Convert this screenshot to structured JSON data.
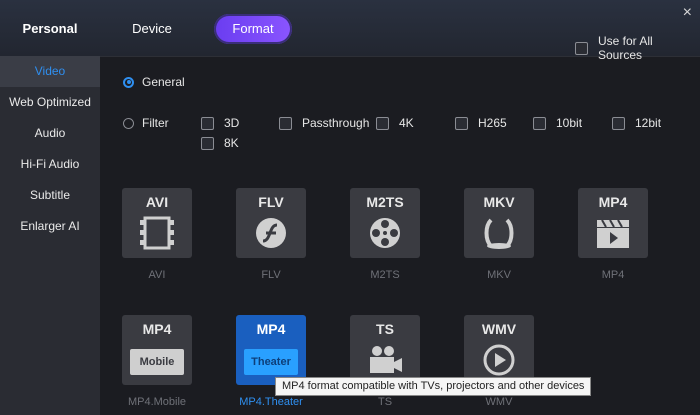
{
  "header": {
    "tabs": [
      {
        "label": "Personal"
      },
      {
        "label": "Device"
      },
      {
        "label": "Format"
      }
    ],
    "close_glyph": "×",
    "use_all_label": "Use for All Sources"
  },
  "sidebar": {
    "items": [
      {
        "label": "Video",
        "active": true
      },
      {
        "label": "Web Optimized"
      },
      {
        "label": "Audio"
      },
      {
        "label": "Hi-Fi Audio"
      },
      {
        "label": "Subtitle"
      },
      {
        "label": "Enlarger AI"
      }
    ]
  },
  "filters": {
    "general_label": "General",
    "filter_label": "Filter",
    "options": [
      "3D",
      "Passthrough",
      "4K",
      "H265",
      "10bit",
      "12bit",
      "8K"
    ]
  },
  "formats": [
    {
      "title": "AVI",
      "label": "AVI",
      "icon": "film-strip-icon"
    },
    {
      "title": "FLV",
      "label": "FLV",
      "icon": "flash-icon"
    },
    {
      "title": "M2TS",
      "label": "M2TS",
      "icon": "film-reel-icon"
    },
    {
      "title": "MKV",
      "label": "MKV",
      "icon": "matroska-icon"
    },
    {
      "title": "MP4",
      "label": "MP4",
      "icon": "clapperboard-icon"
    },
    {
      "title": "MP4",
      "label": "MP4.Mobile",
      "badge": "Mobile",
      "icon": "mobile-badge"
    },
    {
      "title": "MP4",
      "label": "MP4.Theater",
      "badge": "Theater",
      "icon": "theater-badge",
      "selected": true
    },
    {
      "title": "TS",
      "label": "TS",
      "icon": "video-camera-icon"
    },
    {
      "title": "WMV",
      "label": "WMV",
      "icon": "play-circle-icon"
    }
  ],
  "tooltip": "MP4 format compatible with TVs, projectors and other devices",
  "colors": {
    "accent": "#2f8ff0",
    "format_tab": "#7a4af8",
    "background": "#1b1c21",
    "sidebar": "#2a2c33"
  }
}
